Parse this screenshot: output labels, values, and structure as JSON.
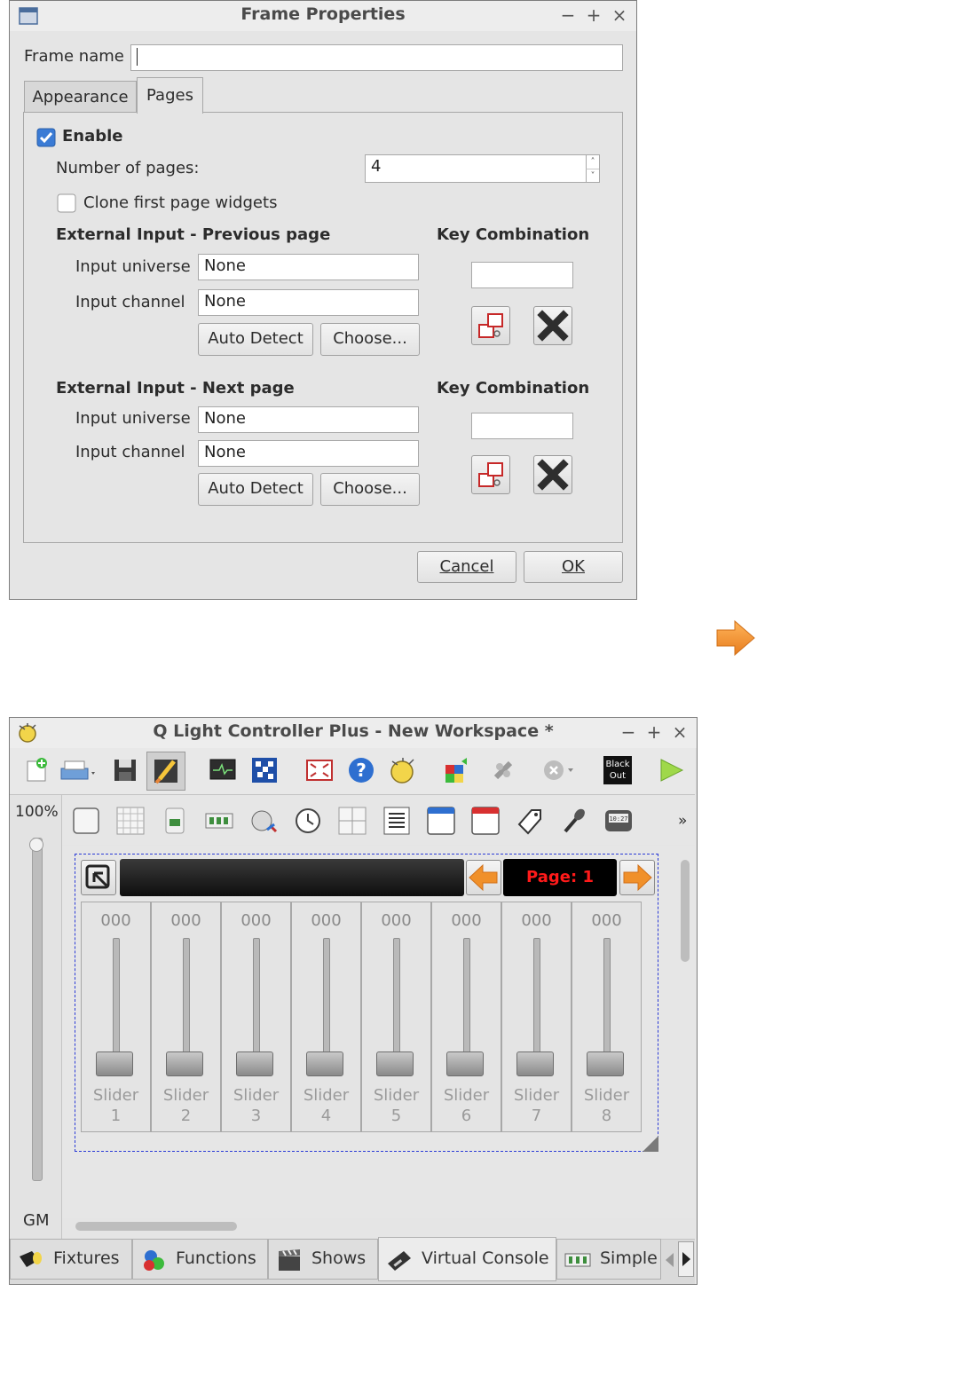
{
  "dialog": {
    "title": "Frame Properties",
    "window_controls": [
      "−",
      "+",
      "×"
    ],
    "frame_name_label": "Frame name",
    "frame_name_value": "",
    "tabs": [
      {
        "label": "Appearance",
        "active": false
      },
      {
        "label": "Pages",
        "active": true
      }
    ],
    "enable_label": "Enable",
    "enable_checked": true,
    "pages_label": "Number of pages:",
    "pages_value": "4",
    "clone_label": "Clone first page widgets",
    "clone_checked": false,
    "prev": {
      "header": "External Input - Previous page",
      "key_header": "Key Combination",
      "universe_label": "Input universe",
      "universe_value": "None",
      "channel_label": "Input channel",
      "channel_value": "None",
      "auto_detect": "Auto Detect",
      "choose": "Choose...",
      "key_value": ""
    },
    "next": {
      "header": "External Input - Next page",
      "key_header": "Key Combination",
      "universe_label": "Input universe",
      "universe_value": "None",
      "channel_label": "Input channel",
      "channel_value": "None",
      "auto_detect": "Auto Detect",
      "choose": "Choose...",
      "key_value": ""
    },
    "cancel_label": "Cancel",
    "ok_label": "OK",
    "check_color": "#3a7bd5"
  },
  "arrow_color": "#f0902a",
  "main": {
    "title": "Q Light Controller Plus - New Workspace *",
    "window_controls": [
      "−",
      "+",
      "×"
    ],
    "toolbar_icons": [
      "new-workspace-icon",
      "open-workspace-icon",
      "save-workspace-icon",
      "edit-mode-icon",
      "dmx-monitor-icon",
      "address-tool-icon",
      "fullscreen-icon",
      "help-icon",
      "about-icon",
      "fixture-remap-icon",
      "disable-input-icon",
      "stop-all-icon",
      "blackout-icon",
      "play-icon"
    ],
    "blackout_label_line1": "Black",
    "blackout_label_line2": "Out",
    "zoom_label": "100%",
    "gm_label": "GM",
    "gm_level": 1.0,
    "vc_toolbar_icons": [
      "button-icon",
      "button-matrix-icon",
      "slider-icon",
      "slider-matrix-icon",
      "knob-icon",
      "speed-dial-icon",
      "xy-pad-icon",
      "cue-list-icon",
      "frame-icon",
      "solo-frame-icon",
      "label-icon",
      "audio-triggers-icon",
      "clock-icon"
    ],
    "more_label": "»",
    "frame": {
      "page_label": "Page: 1",
      "page_color": "#ff1a1a"
    },
    "sliders": [
      {
        "value": "000",
        "label": "Slider 1",
        "level": 0
      },
      {
        "value": "000",
        "label": "Slider 2",
        "level": 0
      },
      {
        "value": "000",
        "label": "Slider 3",
        "level": 0
      },
      {
        "value": "000",
        "label": "Slider 4",
        "level": 0
      },
      {
        "value": "000",
        "label": "Slider 5",
        "level": 0
      },
      {
        "value": "000",
        "label": "Slider 6",
        "level": 0
      },
      {
        "value": "000",
        "label": "Slider 7",
        "level": 0
      },
      {
        "value": "000",
        "label": "Slider 8",
        "level": 0
      }
    ],
    "bottom_tabs": [
      {
        "label": "Fixtures",
        "active": false
      },
      {
        "label": "Functions",
        "active": false
      },
      {
        "label": "Shows",
        "active": false
      },
      {
        "label": "Virtual Console",
        "active": true
      },
      {
        "label": "Simple",
        "active": false
      }
    ]
  }
}
